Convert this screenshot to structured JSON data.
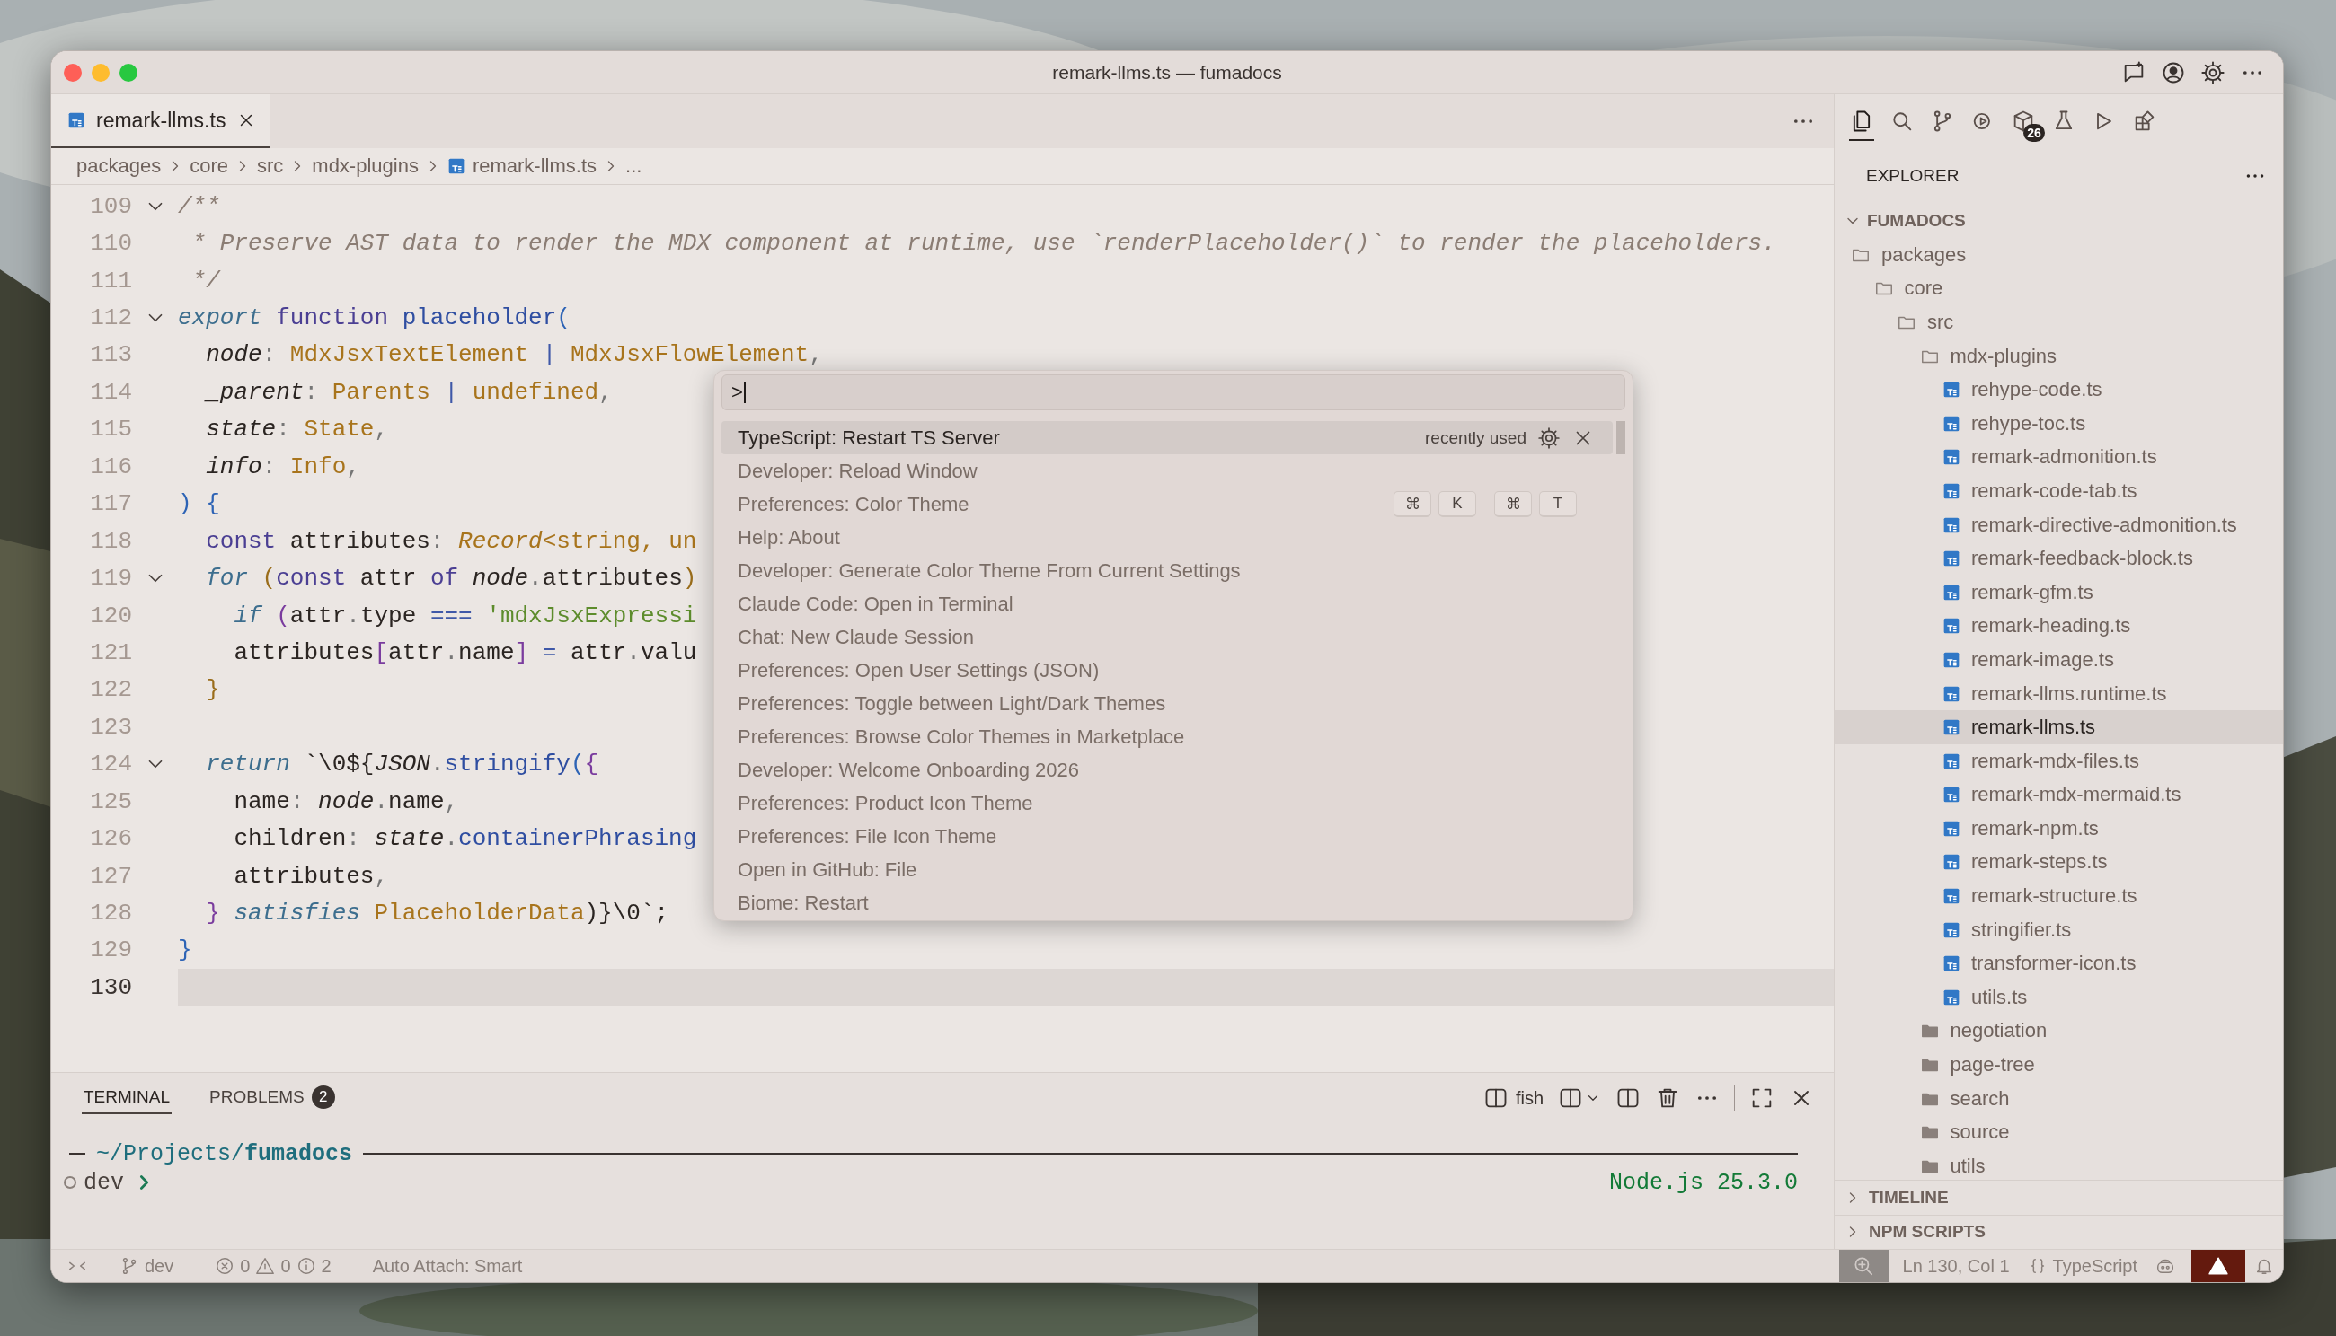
{
  "window": {
    "title": "remark-llms.ts — fumadocs"
  },
  "editor_tabs": [
    {
      "label": "remark-llms.ts",
      "selected": true
    }
  ],
  "breadcrumbs": [
    {
      "label": "packages",
      "kind": "folder"
    },
    {
      "label": "core",
      "kind": "folder"
    },
    {
      "label": "src",
      "kind": "folder"
    },
    {
      "label": "mdx-plugins",
      "kind": "folder"
    },
    {
      "label": "remark-llms.ts",
      "kind": "file"
    },
    {
      "label": "...",
      "kind": "more"
    }
  ],
  "code": {
    "lines": [
      {
        "number": "109",
        "foldable": true,
        "current": false,
        "tokens": [
          {
            "text": "/**",
            "kind": "comment"
          }
        ]
      },
      {
        "number": "110",
        "foldable": false,
        "current": false,
        "tokens": [
          {
            "text": " * Preserve AST data to render the MDX component at runtime, use `renderPlaceholder()` to render the placeholders.",
            "kind": "comment"
          }
        ]
      },
      {
        "number": "111",
        "foldable": false,
        "current": false,
        "tokens": [
          {
            "text": " */",
            "kind": "comment"
          }
        ]
      },
      {
        "number": "112",
        "foldable": true,
        "current": false,
        "tokens": [
          {
            "text": "export",
            "kind": "storage"
          },
          {
            "text": " function",
            "kind": "keyword"
          },
          {
            "text": " placeholder",
            "kind": "fn"
          },
          {
            "text": "(",
            "kind": "paren"
          }
        ]
      },
      {
        "number": "113",
        "foldable": false,
        "current": false,
        "tokens": [
          {
            "text": "  node",
            "kind": "param"
          },
          {
            "text": ": ",
            "kind": "punct"
          },
          {
            "text": "MdxJsxTextElement",
            "kind": "type"
          },
          {
            "text": " | ",
            "kind": "op"
          },
          {
            "text": "MdxJsxFlowElement",
            "kind": "type"
          },
          {
            "text": ",",
            "kind": "punct"
          }
        ]
      },
      {
        "number": "114",
        "foldable": false,
        "current": false,
        "tokens": [
          {
            "text": "  _parent",
            "kind": "param"
          },
          {
            "text": ": ",
            "kind": "punct"
          },
          {
            "text": "Parents",
            "kind": "type"
          },
          {
            "text": " | ",
            "kind": "op"
          },
          {
            "text": "undefined",
            "kind": "type"
          },
          {
            "text": ",",
            "kind": "punct"
          }
        ]
      },
      {
        "number": "115",
        "foldable": false,
        "current": false,
        "tokens": [
          {
            "text": "  state",
            "kind": "param"
          },
          {
            "text": ": ",
            "kind": "punct"
          },
          {
            "text": "State",
            "kind": "type"
          },
          {
            "text": ",",
            "kind": "punct"
          }
        ]
      },
      {
        "number": "116",
        "foldable": false,
        "current": false,
        "tokens": [
          {
            "text": "  info",
            "kind": "param"
          },
          {
            "text": ": ",
            "kind": "punct"
          },
          {
            "text": "Info",
            "kind": "type"
          },
          {
            "text": ",",
            "kind": "punct"
          }
        ]
      },
      {
        "number": "117",
        "foldable": false,
        "current": false,
        "tokens": [
          {
            "text": ") {",
            "kind": "paren"
          }
        ]
      },
      {
        "number": "118",
        "foldable": false,
        "current": false,
        "tokens": [
          {
            "text": "  const",
            "kind": "keyword"
          },
          {
            "text": " attributes",
            "kind": "text"
          },
          {
            "text": ": ",
            "kind": "punct"
          },
          {
            "text": "Record",
            "kind": "typei"
          },
          {
            "text": "<string, un",
            "kind": "type"
          }
        ]
      },
      {
        "number": "119",
        "foldable": true,
        "current": false,
        "tokens": [
          {
            "text": "  for",
            "kind": "storage"
          },
          {
            "text": " (",
            "kind": "brace"
          },
          {
            "text": "const",
            "kind": "keyword"
          },
          {
            "text": " attr ",
            "kind": "text"
          },
          {
            "text": "of",
            "kind": "keyword"
          },
          {
            "text": " node",
            "kind": "param"
          },
          {
            "text": ".",
            "kind": "punct"
          },
          {
            "text": "attributes",
            "kind": "text"
          },
          {
            "text": ")",
            "kind": "brace"
          }
        ]
      },
      {
        "number": "120",
        "foldable": false,
        "current": false,
        "tokens": [
          {
            "text": "    if",
            "kind": "storage"
          },
          {
            "text": " (",
            "kind": "bracket"
          },
          {
            "text": "attr",
            "kind": "text"
          },
          {
            "text": ".",
            "kind": "punct"
          },
          {
            "text": "type",
            "kind": "text"
          },
          {
            "text": " === ",
            "kind": "op"
          },
          {
            "text": "'mdxJsxExpressi",
            "kind": "string"
          }
        ]
      },
      {
        "number": "121",
        "foldable": false,
        "current": false,
        "tokens": [
          {
            "text": "    attributes",
            "kind": "text"
          },
          {
            "text": "[",
            "kind": "bracket"
          },
          {
            "text": "attr",
            "kind": "text"
          },
          {
            "text": ".",
            "kind": "punct"
          },
          {
            "text": "name",
            "kind": "text"
          },
          {
            "text": "]",
            "kind": "bracket"
          },
          {
            "text": " = ",
            "kind": "op"
          },
          {
            "text": "attr",
            "kind": "text"
          },
          {
            "text": ".",
            "kind": "punct"
          },
          {
            "text": "valu",
            "kind": "text"
          }
        ]
      },
      {
        "number": "122",
        "foldable": false,
        "current": false,
        "tokens": [
          {
            "text": "  }",
            "kind": "brace"
          }
        ]
      },
      {
        "number": "123",
        "foldable": false,
        "current": false
      },
      {
        "number": "124",
        "foldable": true,
        "current": false,
        "tokens": [
          {
            "text": "  return",
            "kind": "storage"
          },
          {
            "text": " `\\0${",
            "kind": "text"
          },
          {
            "text": "JSON",
            "kind": "param"
          },
          {
            "text": ".",
            "kind": "punct"
          },
          {
            "text": "stringify",
            "kind": "fn"
          },
          {
            "text": "(",
            "kind": "paren"
          },
          {
            "text": "{",
            "kind": "bracket"
          }
        ]
      },
      {
        "number": "125",
        "foldable": false,
        "current": false,
        "tokens": [
          {
            "text": "    name",
            "kind": "text"
          },
          {
            "text": ": ",
            "kind": "punct"
          },
          {
            "text": "node",
            "kind": "param"
          },
          {
            "text": ".",
            "kind": "punct"
          },
          {
            "text": "name",
            "kind": "text"
          },
          {
            "text": ",",
            "kind": "punct"
          }
        ]
      },
      {
        "number": "126",
        "foldable": false,
        "current": false,
        "tokens": [
          {
            "text": "    children",
            "kind": "text"
          },
          {
            "text": ": ",
            "kind": "punct"
          },
          {
            "text": "state",
            "kind": "param"
          },
          {
            "text": ".",
            "kind": "punct"
          },
          {
            "text": "containerPhrasing",
            "kind": "fn"
          }
        ]
      },
      {
        "number": "127",
        "foldable": false,
        "current": false,
        "tokens": [
          {
            "text": "    attributes",
            "kind": "text"
          },
          {
            "text": ",",
            "kind": "punct"
          }
        ]
      },
      {
        "number": "128",
        "foldable": false,
        "current": false,
        "tokens": [
          {
            "text": "  }",
            "kind": "bracket"
          },
          {
            "text": " satisfies",
            "kind": "storage"
          },
          {
            "text": " PlaceholderData",
            "kind": "type"
          },
          {
            "text": ")}\\0`;",
            "kind": "text"
          }
        ]
      },
      {
        "number": "129",
        "foldable": false,
        "current": false,
        "tokens": [
          {
            "text": "}",
            "kind": "paren"
          }
        ]
      },
      {
        "number": "130",
        "foldable": false,
        "current": true
      }
    ]
  },
  "command_palette": {
    "value": ">",
    "items": [
      {
        "label": "TypeScript: Restart TS Server",
        "selected": true,
        "detail": "recently used"
      },
      {
        "label": "Developer: Reload Window",
        "selected": false
      },
      {
        "label": "Preferences: Color Theme",
        "selected": false,
        "keys": [
          [
            "⌘",
            "K"
          ],
          [
            "⌘",
            "T"
          ]
        ]
      },
      {
        "label": "Help: About",
        "selected": false
      },
      {
        "label": "Developer: Generate Color Theme From Current Settings",
        "selected": false
      },
      {
        "label": "Claude Code: Open in Terminal",
        "selected": false
      },
      {
        "label": "Chat: New Claude Session",
        "selected": false
      },
      {
        "label": "Preferences: Open User Settings (JSON)",
        "selected": false
      },
      {
        "label": "Preferences: Toggle between Light/Dark Themes",
        "selected": false
      },
      {
        "label": "Preferences: Browse Color Themes in Marketplace",
        "selected": false
      },
      {
        "label": "Developer: Welcome Onboarding 2026",
        "selected": false
      },
      {
        "label": "Preferences: Product Icon Theme",
        "selected": false
      },
      {
        "label": "Preferences: File Icon Theme",
        "selected": false
      },
      {
        "label": "Open in GitHub: File",
        "selected": false
      },
      {
        "label": "Biome: Restart",
        "selected": false
      }
    ]
  },
  "activity_bar": [
    {
      "kind": "files",
      "selected": true
    },
    {
      "kind": "search",
      "selected": false
    },
    {
      "kind": "source-control",
      "selected": false
    },
    {
      "kind": "debug",
      "selected": false
    },
    {
      "kind": "package",
      "selected": false,
      "badge": "26"
    },
    {
      "kind": "testing",
      "selected": false
    },
    {
      "kind": "run",
      "selected": false
    },
    {
      "kind": "extensions",
      "selected": false
    }
  ],
  "explorer": {
    "title": "EXPLORER",
    "workspace": {
      "label": "FUMADOCS",
      "expanded": true
    },
    "tree": [
      {
        "label": "packages",
        "kind": "folder",
        "expanded": true,
        "selected": false,
        "children": [
          {
            "label": "core",
            "kind": "folder",
            "expanded": true,
            "selected": false,
            "children": [
              {
                "label": "src",
                "kind": "folder",
                "expanded": true,
                "selected": false,
                "children": [
                  {
                    "label": "mdx-plugins",
                    "kind": "folder",
                    "expanded": true,
                    "selected": false,
                    "children": [
                      {
                        "label": "rehype-code.ts",
                        "kind": "file",
                        "selected": false
                      },
                      {
                        "label": "rehype-toc.ts",
                        "kind": "file",
                        "selected": false
                      },
                      {
                        "label": "remark-admonition.ts",
                        "kind": "file",
                        "selected": false
                      },
                      {
                        "label": "remark-code-tab.ts",
                        "kind": "file",
                        "selected": false
                      },
                      {
                        "label": "remark-directive-admonition.ts",
                        "kind": "file",
                        "selected": false
                      },
                      {
                        "label": "remark-feedback-block.ts",
                        "kind": "file",
                        "selected": false
                      },
                      {
                        "label": "remark-gfm.ts",
                        "kind": "file",
                        "selected": false
                      },
                      {
                        "label": "remark-heading.ts",
                        "kind": "file",
                        "selected": false
                      },
                      {
                        "label": "remark-image.ts",
                        "kind": "file",
                        "selected": false
                      },
                      {
                        "label": "remark-llms.runtime.ts",
                        "kind": "file",
                        "selected": false
                      },
                      {
                        "label": "remark-llms.ts",
                        "kind": "file",
                        "selected": true
                      },
                      {
                        "label": "remark-mdx-files.ts",
                        "kind": "file",
                        "selected": false
                      },
                      {
                        "label": "remark-mdx-mermaid.ts",
                        "kind": "file",
                        "selected": false
                      },
                      {
                        "label": "remark-npm.ts",
                        "kind": "file",
                        "selected": false
                      },
                      {
                        "label": "remark-steps.ts",
                        "kind": "file",
                        "selected": false
                      },
                      {
                        "label": "remark-structure.ts",
                        "kind": "file",
                        "selected": false
                      },
                      {
                        "label": "stringifier.ts",
                        "kind": "file",
                        "selected": false
                      },
                      {
                        "label": "transformer-icon.ts",
                        "kind": "file",
                        "selected": false
                      },
                      {
                        "label": "utils.ts",
                        "kind": "file",
                        "selected": false
                      }
                    ]
                  },
                  {
                    "label": "negotiation",
                    "kind": "folder",
                    "expanded": false,
                    "selected": false
                  },
                  {
                    "label": "page-tree",
                    "kind": "folder",
                    "expanded": false,
                    "selected": false
                  },
                  {
                    "label": "search",
                    "kind": "folder",
                    "expanded": false,
                    "selected": false
                  },
                  {
                    "label": "source",
                    "kind": "folder",
                    "expanded": false,
                    "selected": false
                  },
                  {
                    "label": "utils",
                    "kind": "folder",
                    "expanded": false,
                    "selected": false
                  }
                ]
              }
            ]
          }
        ]
      }
    ],
    "sections": [
      {
        "label": "TIMELINE",
        "expanded": false
      },
      {
        "label": "NPM SCRIPTS",
        "expanded": false
      }
    ]
  },
  "panel": {
    "tabs": [
      {
        "label": "TERMINAL",
        "selected": true
      },
      {
        "label": "PROBLEMS",
        "selected": false,
        "badge": "2"
      }
    ],
    "shell": "fish",
    "terminal": {
      "cwd": "~/Projects/**fumadocs**",
      "prompt": "dev",
      "runtime": "Node.js 25.3.0"
    }
  },
  "status_bar": {
    "branch": "dev",
    "errors": "0",
    "warnings": "0",
    "infos": "2",
    "auto_attach": "Auto Attach: Smart",
    "position": "Ln 130, Col 1",
    "language": "TypeScript"
  }
}
